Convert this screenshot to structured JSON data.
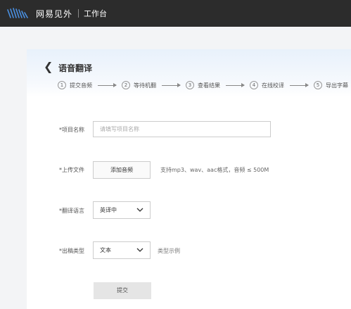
{
  "header": {
    "brand": "网易见外",
    "workbench": "工作台"
  },
  "page": {
    "title": "语音翻译"
  },
  "steps": [
    {
      "num": "1",
      "label": "提交音频"
    },
    {
      "num": "2",
      "label": "等待机翻"
    },
    {
      "num": "3",
      "label": "查看结果"
    },
    {
      "num": "4",
      "label": "在线校译"
    },
    {
      "num": "5",
      "label": "导出字幕"
    }
  ],
  "form": {
    "project_label": "*项目名称",
    "project_placeholder": "请填写项目名称",
    "upload_label": "*上传文件",
    "upload_button": "添加音频",
    "upload_hint": "支持mp3、wav、aac格式，音频 ≤ 500M",
    "language_label": "*翻译语言",
    "language_value": "英译中",
    "output_label": "*出稿类型",
    "output_value": "文本",
    "output_example": "类型示例",
    "submit": "提交"
  },
  "colors": {
    "topbar": "#2c2c2c",
    "logo": "#4a90e2"
  }
}
